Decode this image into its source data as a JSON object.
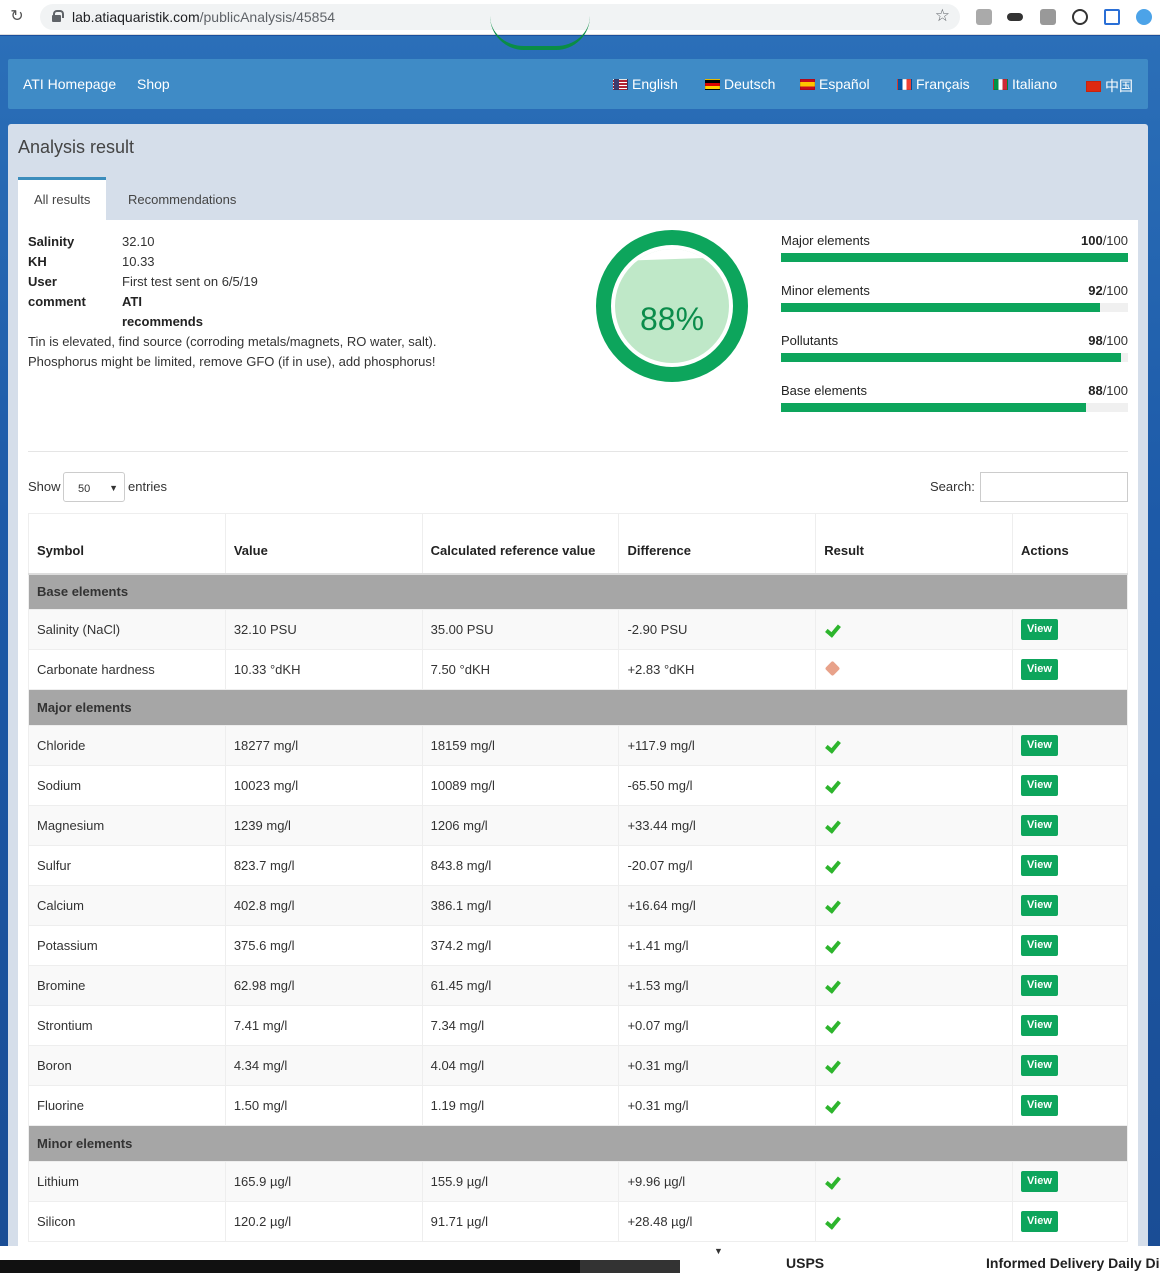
{
  "browser": {
    "url_host": "lab.atiaquaristik.com",
    "url_path": "/publicAnalysis/45854"
  },
  "nav": {
    "home": "ATI Homepage",
    "shop": "Shop",
    "languages": [
      "English",
      "Deutsch",
      "Español",
      "Français",
      "Italiano",
      "中国"
    ]
  },
  "panel": {
    "title": "Analysis result",
    "tabs": [
      "All results",
      "Recommendations"
    ]
  },
  "summary": {
    "salinity_label": "Salinity",
    "salinity_value": "32.10",
    "kh_label": "KH",
    "kh_value": "10.33",
    "user_label": "User",
    "user_value": "First test sent on 6/5/19",
    "comment_label": "comment",
    "comment_value": "ATI",
    "recommends": "recommends",
    "recommendation_1": "Tin is elevated, find source (corroding metals/magnets, RO water, salt).",
    "recommendation_2": "Phosphorus might be limited, remove GFO (if in use), add phosphorus!"
  },
  "gauge": {
    "percent": 88,
    "text": "88%"
  },
  "scores": [
    {
      "label": "Major elements",
      "score": "100",
      "max": "/100",
      "value": 100
    },
    {
      "label": "Minor elements",
      "score": "92",
      "max": "/100",
      "value": 92
    },
    {
      "label": "Pollutants",
      "score": "98",
      "max": "/100",
      "value": 98
    },
    {
      "label": "Base elements",
      "score": "88",
      "max": "/100",
      "value": 88
    }
  ],
  "table_controls": {
    "show": "Show",
    "page_size": "50",
    "entries": "entries",
    "search_label": "Search:"
  },
  "table": {
    "headers": [
      "Symbol",
      "Value",
      "Calculated reference value",
      "Difference",
      "Result",
      "Actions"
    ],
    "view_label": "View",
    "groups": [
      {
        "name": "Base elements",
        "rows": [
          [
            "Salinity (NaCl)",
            "32.10 PSU",
            "35.00 PSU",
            "-2.90 PSU",
            "ok"
          ],
          [
            "Carbonate hardness",
            "10.33 °dKH",
            "7.50 °dKH",
            "+2.83 °dKH",
            "warn"
          ]
        ]
      },
      {
        "name": "Major elements",
        "rows": [
          [
            "Chloride",
            "18277 mg/l",
            "18159 mg/l",
            "+117.9 mg/l",
            "ok"
          ],
          [
            "Sodium",
            "10023 mg/l",
            "10089 mg/l",
            "-65.50 mg/l",
            "ok"
          ],
          [
            "Magnesium",
            "1239 mg/l",
            "1206 mg/l",
            "+33.44 mg/l",
            "ok"
          ],
          [
            "Sulfur",
            "823.7 mg/l",
            "843.8 mg/l",
            "-20.07 mg/l",
            "ok"
          ],
          [
            "Calcium",
            "402.8 mg/l",
            "386.1 mg/l",
            "+16.64 mg/l",
            "ok"
          ],
          [
            "Potassium",
            "375.6 mg/l",
            "374.2 mg/l",
            "+1.41 mg/l",
            "ok"
          ],
          [
            "Bromine",
            "62.98 mg/l",
            "61.45 mg/l",
            "+1.53 mg/l",
            "ok"
          ],
          [
            "Strontium",
            "7.41 mg/l",
            "7.34 mg/l",
            "+0.07 mg/l",
            "ok"
          ],
          [
            "Boron",
            "4.34 mg/l",
            "4.04 mg/l",
            "+0.31 mg/l",
            "ok"
          ],
          [
            "Fluorine",
            "1.50 mg/l",
            "1.19 mg/l",
            "+0.31 mg/l",
            "ok"
          ]
        ]
      },
      {
        "name": "Minor elements",
        "rows": [
          [
            "Lithium",
            "165.9 µg/l",
            "155.9 µg/l",
            "+9.96 µg/l",
            "ok"
          ],
          [
            "Silicon",
            "120.2 µg/l",
            "91.71 µg/l",
            "+28.48 µg/l",
            "ok"
          ]
        ]
      }
    ]
  },
  "bookmarks": {
    "usps": "USPS",
    "informed": "Informed Delivery Daily Dig"
  }
}
